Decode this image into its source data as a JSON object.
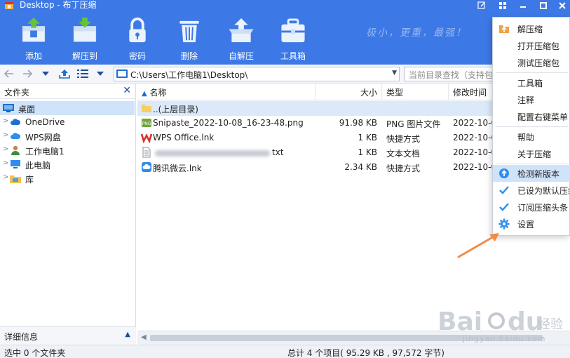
{
  "window": {
    "title": "Desktop - 布丁压缩",
    "controls": [
      "edit-icon",
      "grid-icon",
      "minimize",
      "maximize",
      "close"
    ]
  },
  "toolbar": {
    "buttons": [
      {
        "label": "添加",
        "icon": "add-archive-icon"
      },
      {
        "label": "解压到",
        "icon": "extract-to-icon"
      },
      {
        "label": "密码",
        "icon": "lock-icon"
      },
      {
        "label": "删除",
        "icon": "trash-icon"
      },
      {
        "label": "自解压",
        "icon": "self-extract-icon"
      },
      {
        "label": "工具箱",
        "icon": "toolbox-icon"
      }
    ],
    "slogan": "极小，更重，最强！"
  },
  "address": {
    "path": "C:\\Users\\工作电脑1\\Desktop\\",
    "search_placeholder": "当前目录查找（支持包"
  },
  "sidebar": {
    "title": "文件夹",
    "items": [
      {
        "label": "桌面",
        "icon": "desktop-icon",
        "selected": true
      },
      {
        "label": "OneDrive",
        "icon": "cloud-icon"
      },
      {
        "label": "WPS网盘",
        "icon": "cloud-icon"
      },
      {
        "label": "工作电脑1",
        "icon": "user-icon"
      },
      {
        "label": "此电脑",
        "icon": "computer-icon"
      },
      {
        "label": "库",
        "icon": "library-icon"
      }
    ],
    "footer": "详细信息"
  },
  "filelist": {
    "columns": [
      "名称",
      "大小",
      "类型",
      "修改时间"
    ],
    "rows": [
      {
        "name": "..(上层目录)",
        "size": "",
        "type": "",
        "modified": "",
        "icon": "folder-icon"
      },
      {
        "name": "Snipaste_2022-10-08_16-23-48.png",
        "size": "91.98 KB",
        "type": "PNG 图片文件",
        "modified": "2022-10-0",
        "icon": "image-file-icon"
      },
      {
        "name": "WPS Office.lnk",
        "size": "1 KB",
        "type": "快捷方式",
        "modified": "2022-10-0",
        "icon": "wps-icon"
      },
      {
        "name": "txt",
        "size": "1 KB",
        "type": "文本文档",
        "modified": "2022-10-0",
        "icon": "text-file-icon"
      },
      {
        "name": "腾讯微云.lnk",
        "size": "2.34 KB",
        "type": "快捷方式",
        "modified": "2022-10-0",
        "icon": "weiyun-icon"
      }
    ]
  },
  "status": {
    "selection": "选中 0 个文件夹",
    "summary": "总计 4 个项目( 95.29 KB , 97,572 字节)"
  },
  "menu": {
    "items": [
      {
        "label": "解压缩",
        "icon": "extract-icon"
      },
      {
        "label": "打开压缩包",
        "icon": ""
      },
      {
        "label": "测试压缩包",
        "icon": ""
      },
      {
        "label": "工具箱",
        "icon": ""
      },
      {
        "label": "注释",
        "icon": ""
      },
      {
        "label": "配置右键菜单",
        "icon": ""
      },
      {
        "label": "帮助",
        "icon": ""
      },
      {
        "label": "关于压缩",
        "icon": ""
      },
      {
        "label": "检测新版本",
        "icon": "upgrade-icon",
        "highlighted": true
      },
      {
        "label": "已设为默认压缩",
        "icon": "check-icon"
      },
      {
        "label": "订阅压缩头条",
        "icon": "check-icon"
      },
      {
        "label": "设置",
        "icon": "gear-icon"
      }
    ]
  },
  "watermark": {
    "brand": "Baidu经验",
    "url": "jingyan.baidu.com"
  },
  "colors": {
    "header": "#3d79e6",
    "selection": "#cfe3fa",
    "accent": "#1f6fd0",
    "arrow": "#f08c45"
  }
}
